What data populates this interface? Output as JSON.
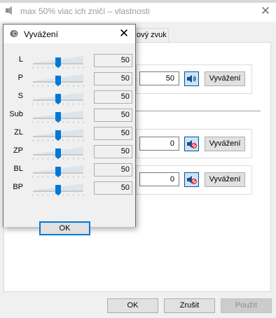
{
  "parent_window": {
    "title": "max 50% viac ich zničí – vlastnosti",
    "behind_title_text": "...",
    "tab_partial_label": "ový zvuk",
    "groups": [
      {
        "value": "50",
        "speaker_icon": "speaker-icon",
        "button_label": "Vyvážení"
      },
      {
        "value": "0",
        "speaker_icon": "speaker-muted-icon",
        "button_label": "Vyvážení"
      },
      {
        "value": "0",
        "speaker_icon": "speaker-muted-icon",
        "button_label": "Vyvážení"
      }
    ],
    "buttons": {
      "ok": "OK",
      "cancel": "Zrušit",
      "apply": "Použít"
    }
  },
  "balance_dialog": {
    "title": "Vyvážení",
    "channels": [
      {
        "label": "L",
        "value": "50",
        "level": 50
      },
      {
        "label": "P",
        "value": "50",
        "level": 50
      },
      {
        "label": "S",
        "value": "50",
        "level": 50
      },
      {
        "label": "Sub",
        "value": "50",
        "level": 50
      },
      {
        "label": "ZL",
        "value": "50",
        "level": 50
      },
      {
        "label": "ZP",
        "value": "50",
        "level": 50
      },
      {
        "label": "BL",
        "value": "50",
        "level": 50
      },
      {
        "label": "BP",
        "value": "50",
        "level": 50
      }
    ],
    "ok_label": "OK"
  },
  "colors": {
    "accent": "#0078d7",
    "speaker_bg": "#cce4f7",
    "mute_red": "#e81123"
  }
}
